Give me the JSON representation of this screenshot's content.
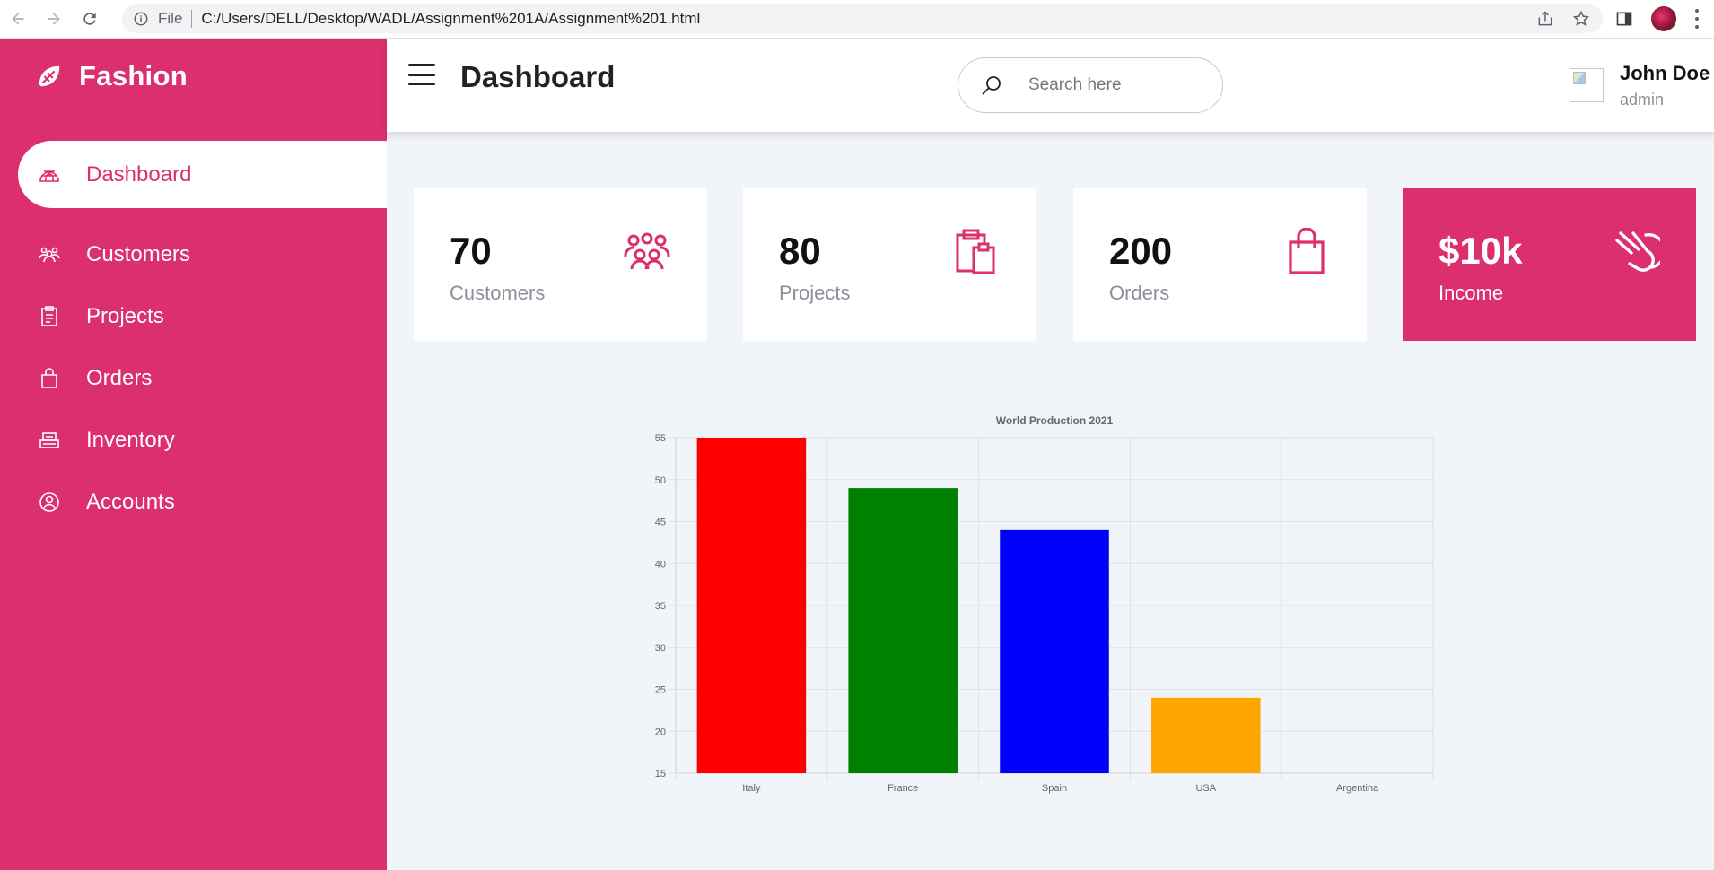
{
  "browser": {
    "scheme": "File",
    "url": "C:/Users/DELL/Desktop/WADL/Assignment%201A/Assignment%201.html"
  },
  "brand": {
    "name": "Fashion",
    "icon": "leaf-logo-icon"
  },
  "sidebar": {
    "items": [
      {
        "label": "Dashboard",
        "icon": "igloo-icon",
        "active": true
      },
      {
        "label": "Customers",
        "icon": "users-icon"
      },
      {
        "label": "Projects",
        "icon": "clipboard-icon"
      },
      {
        "label": "Orders",
        "icon": "shopping-bag-icon"
      },
      {
        "label": "Inventory",
        "icon": "inventory-icon"
      },
      {
        "label": "Accounts",
        "icon": "account-circle-icon"
      }
    ]
  },
  "header": {
    "title": "Dashboard",
    "search_placeholder": "Search here",
    "user_name": "John Doe",
    "user_role": "admin"
  },
  "cards": [
    {
      "value": "70",
      "label": "Customers",
      "icon": "users-icon"
    },
    {
      "value": "80",
      "label": "Projects",
      "icon": "clipboard-icon"
    },
    {
      "value": "200",
      "label": "Orders",
      "icon": "shopping-bag-icon"
    },
    {
      "value": "$10k",
      "label": "Income",
      "icon": "wallet-icon"
    }
  ],
  "colors": {
    "accent": "#dc2f6e"
  },
  "chart_data": {
    "type": "bar",
    "title": "World Production 2021",
    "categories": [
      "Italy",
      "France",
      "Spain",
      "USA",
      "Argentina"
    ],
    "values": [
      55,
      49,
      44,
      24,
      15
    ],
    "colors": [
      "red",
      "green",
      "blue",
      "orange",
      "brown"
    ],
    "ylim": [
      15,
      55
    ],
    "yticks": [
      15,
      20,
      25,
      30,
      35,
      40,
      45,
      50,
      55
    ],
    "grid": true,
    "legend": "none"
  }
}
